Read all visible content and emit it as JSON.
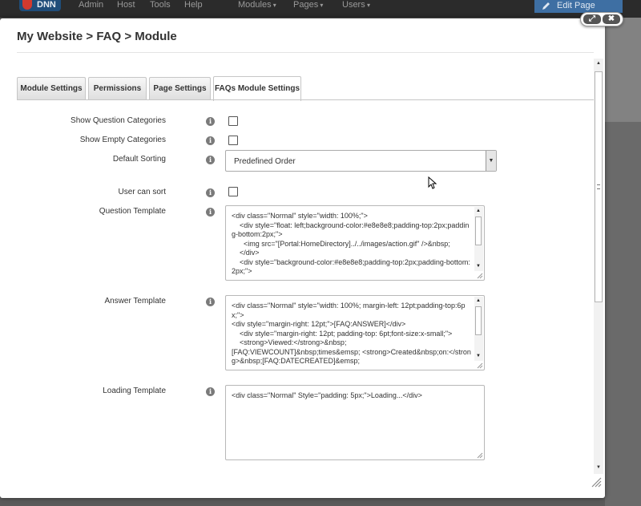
{
  "topbar": {
    "logo": "DNN",
    "nav": [
      "Admin",
      "Host",
      "Tools",
      "Help",
      "Modules",
      "Pages",
      "Users"
    ],
    "edit_page": "Edit Page"
  },
  "dialog": {
    "title": "My Website > FAQ > Module",
    "controls": {
      "maximize": "⤢",
      "close": "✖"
    }
  },
  "tabs": [
    {
      "label": "Module Settings",
      "active": false
    },
    {
      "label": "Permissions",
      "active": false
    },
    {
      "label": "Page Settings",
      "active": false
    },
    {
      "label": "FAQs Module Settings",
      "active": true
    }
  ],
  "form": {
    "show_question_categories": {
      "label": "Show Question Categories",
      "checked": false
    },
    "show_empty_categories": {
      "label": "Show Empty Categories",
      "checked": false
    },
    "default_sorting": {
      "label": "Default Sorting",
      "value": "Predefined Order"
    },
    "user_can_sort": {
      "label": "User can sort",
      "checked": false
    },
    "question_template": {
      "label": "Question Template",
      "value": "<div class=\"Normal\" style=\"width: 100%;\">\n    <div style=\"float: left;background-color:#e8e8e8;padding-top:2px;padding-bottom:2px;\">\n      <img src=\"[Portal:HomeDirectory]../../images/action.gif\" />&nbsp;\n    </div>\n    <div style=\"background-color:#e8e8e8;padding-top:2px;padding-bottom:2px;\">"
    },
    "answer_template": {
      "label": "Answer Template",
      "value": "<div class=\"Normal\" style=\"width: 100%; margin-left: 12pt;padding-top:6px;\">\n<div style=\"margin-right: 12pt;\">[FAQ:ANSWER]</div>\n    <div style=\"margin-right: 12pt; padding-top: 6pt;font-size:x-small;\">\n    <strong>Viewed:</strong>&nbsp;\n[FAQ:VIEWCOUNT]&nbsp;times&emsp; <strong>Created&nbsp;on:</strong>&nbsp;[FAQ:DATECREATED]&emsp;"
    },
    "loading_template": {
      "label": "Loading Template",
      "value": "<div class=\"Normal\" Style=\"padding: 5px;\">Loading...</div>"
    },
    "info_glyph": "i"
  }
}
